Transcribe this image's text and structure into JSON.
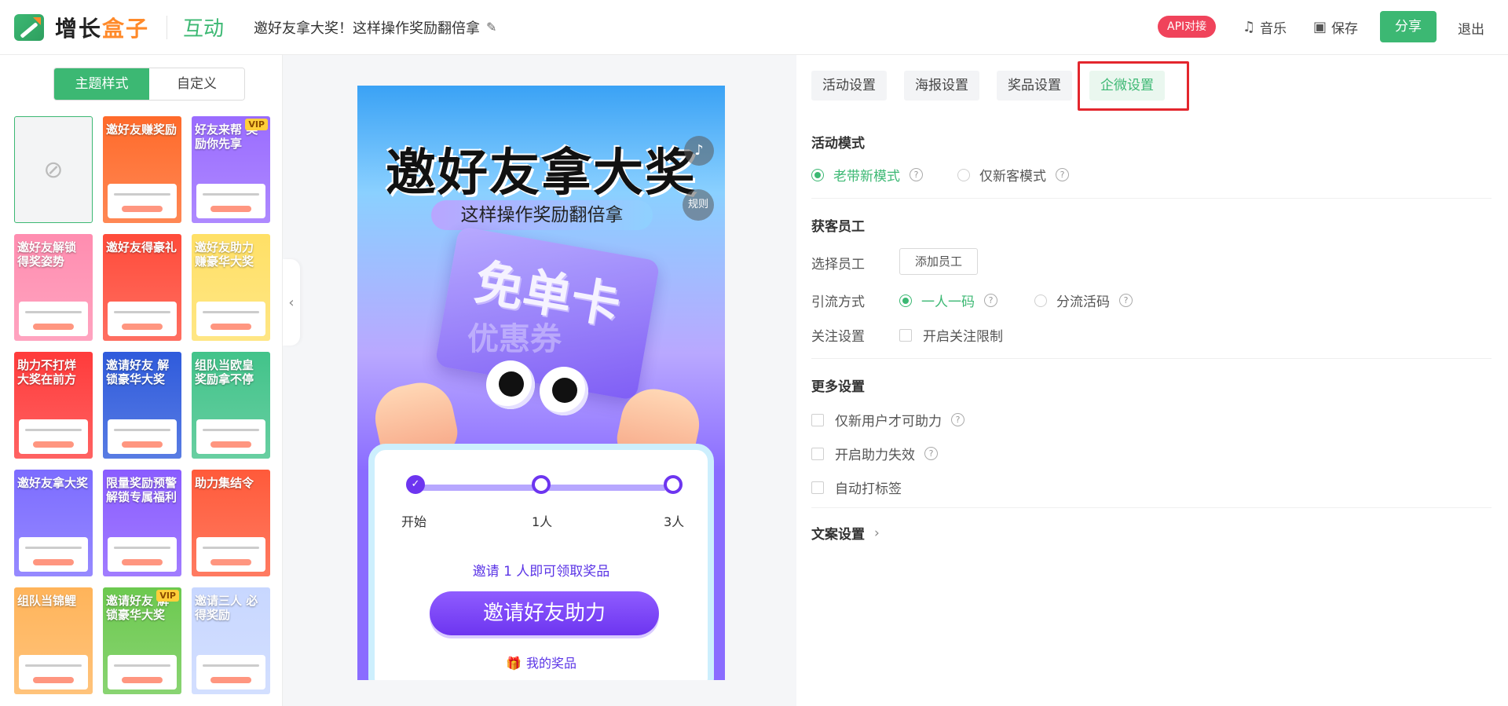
{
  "header": {
    "logo_text_a": "增长",
    "logo_text_b": "盒子",
    "module": "互动",
    "activity_title": "邀好友拿大奖！这样操作奖励翻倍拿",
    "api_badge": "API对接",
    "music": "音乐",
    "save": "保存",
    "share": "分享",
    "exit": "退出",
    "icons": {
      "edit": "edit-icon",
      "music": "music-icon",
      "save": "save-icon"
    }
  },
  "left": {
    "seg": [
      "主题样式",
      "自定义"
    ],
    "templates": [
      {
        "title": "",
        "empty": true
      },
      {
        "title": "邀好友赚奖励",
        "bg": "#ff6a2a",
        "vip": ""
      },
      {
        "title": "好友来帮 奖励你先享",
        "bg": "#9a6cff",
        "vip": "VIP"
      },
      {
        "title": "邀好友解锁 得奖姿势",
        "bg": "#ff8db0",
        "vip": ""
      },
      {
        "title": "邀好友得豪礼",
        "bg": "#ff4b3a",
        "vip": ""
      },
      {
        "title": "邀好友助力 赚豪华大奖",
        "bg": "#ffe066",
        "vip": ""
      },
      {
        "title": "助力不打烊 大奖在前方",
        "bg": "#ff3b3b",
        "vip": ""
      },
      {
        "title": "邀请好友 解锁豪华大奖",
        "bg": "#2f5bdc",
        "vip": ""
      },
      {
        "title": "组队当欧皇 奖励拿不停",
        "bg": "#42c38a",
        "vip": ""
      },
      {
        "title": "邀好友拿大奖",
        "bg": "#7c6cff",
        "vip": ""
      },
      {
        "title": "限量奖励预警 解锁专属福利",
        "bg": "#8a5cff",
        "vip": ""
      },
      {
        "title": "助力集结令",
        "bg": "#ff5a3a",
        "vip": ""
      },
      {
        "title": "组队当锦鲤",
        "bg": "#ffb45a",
        "vip": ""
      },
      {
        "title": "邀请好友 解锁豪华大奖",
        "bg": "#6cc94f",
        "vip": "VIP"
      },
      {
        "title": "邀请三人 必得奖励",
        "bg": "#c8d7ff",
        "vip": ""
      }
    ]
  },
  "preview": {
    "title": "邀好友拿大奖",
    "subtitle": "这样操作奖励翻倍拿",
    "card_text": "免单卡",
    "coupon_text": "优惠券",
    "rules": "规则",
    "steps": [
      "开始",
      "1人",
      "3人"
    ],
    "hint": "邀请 1 人即可领取奖品",
    "invite_button": "邀请好友助力",
    "my_prize": "我的奖品"
  },
  "right": {
    "tabs": [
      "活动设置",
      "海报设置",
      "奖品设置",
      "企微设置"
    ],
    "active_tab": 3,
    "mode_title": "活动模式",
    "mode_options": [
      "老带新模式",
      "仅新客模式"
    ],
    "staff_title": "获客员工",
    "select_staff_label": "选择员工",
    "add_staff_button": "添加员工",
    "traffic_label": "引流方式",
    "traffic_options": [
      "一人一码",
      "分流活码"
    ],
    "follow_label": "关注设置",
    "follow_option": "开启关注限制",
    "more_title": "更多设置",
    "more_options": [
      "仅新用户才可助力",
      "开启助力失效",
      "自动打标签"
    ],
    "copy_settings": "文案设置"
  },
  "colors": {
    "brand_green": "#3cb873",
    "api_red": "#f0435b",
    "highlight_red": "#e3262d",
    "purple": "#6d35f0"
  }
}
